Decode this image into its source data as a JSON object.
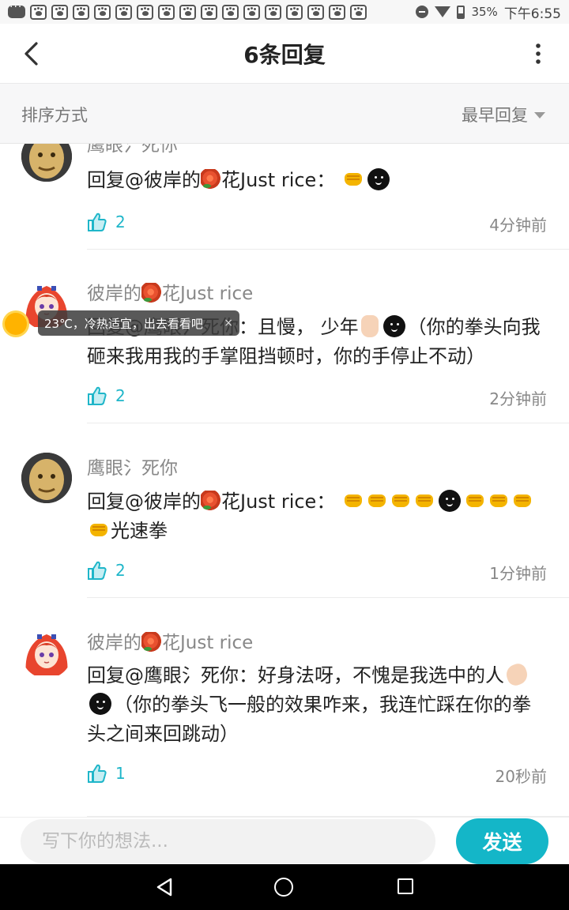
{
  "status_bar": {
    "battery": "35%",
    "time": "下午6:55"
  },
  "header": {
    "title": "6条回复"
  },
  "sort": {
    "label": "排序方式",
    "value": "最早回复"
  },
  "comments": [
    {
      "name": "鹰眼氵死你",
      "reply_prefix": "回复@彼岸的",
      "reply_suffix": "花Just rice：",
      "likes": "2",
      "time": "4分钟前"
    },
    {
      "name_before": "彼岸的",
      "name_after": "花Just rice",
      "text1": "回复@鹰眼氵死你：且慢， 少年",
      "text2": "（你的拳头向我砸来我用我的手掌阻挡顿时，你的手停止不动）",
      "likes": "2",
      "time": "2分钟前"
    },
    {
      "name": "鹰眼氵死你",
      "reply_prefix": "回复@彼岸的",
      "reply_suffix": "花Just rice：",
      "text_end": "光速拳",
      "likes": "2",
      "time": "1分钟前"
    },
    {
      "name_before": "彼岸的",
      "name_after": "花Just rice",
      "text1": "回复@鹰眼氵死你：好身法呀，不愧是我选中的人",
      "text2": "（你的拳头飞一般的效果咋来，我连忙踩在你的拳头之间来回跳动）",
      "likes": "1",
      "time": "20秒前"
    }
  ],
  "weather_toast": {
    "text": "23℃，冷热适宜，出去看看吧",
    "close": "×"
  },
  "input": {
    "placeholder": "写下你的想法..."
  },
  "send_label": "发送",
  "colors": {
    "accent": "#14b6c8",
    "like": "#1fb6c9"
  }
}
